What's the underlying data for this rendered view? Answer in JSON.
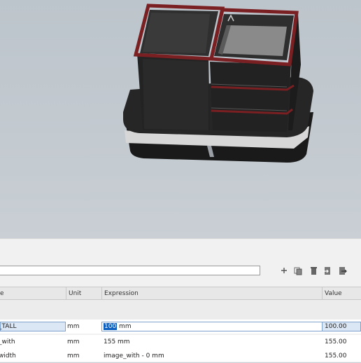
{
  "toolbar": {
    "icons": [
      "plus-icon",
      "copy-icon",
      "delete-icon",
      "import-icon",
      "export-icon"
    ]
  },
  "table": {
    "columns": {
      "name": "e",
      "unit": "Unit",
      "expression": "Expression",
      "value": "Value"
    },
    "rows": [
      {
        "name": "_TALL",
        "unit": "mm",
        "expression_selected": "100",
        "expression_rest": " mm",
        "value": "100.00"
      },
      {
        "name": "_with",
        "unit": "mm",
        "expression": "155 mm",
        "value": "155.00"
      },
      {
        "name": "width",
        "unit": "mm",
        "expression": "image_with - 0 mm",
        "value": "155.00"
      }
    ]
  },
  "colors": {
    "accent": "#0a5fbf",
    "rim": "#7a1f22",
    "body": "#1e1e1e"
  }
}
